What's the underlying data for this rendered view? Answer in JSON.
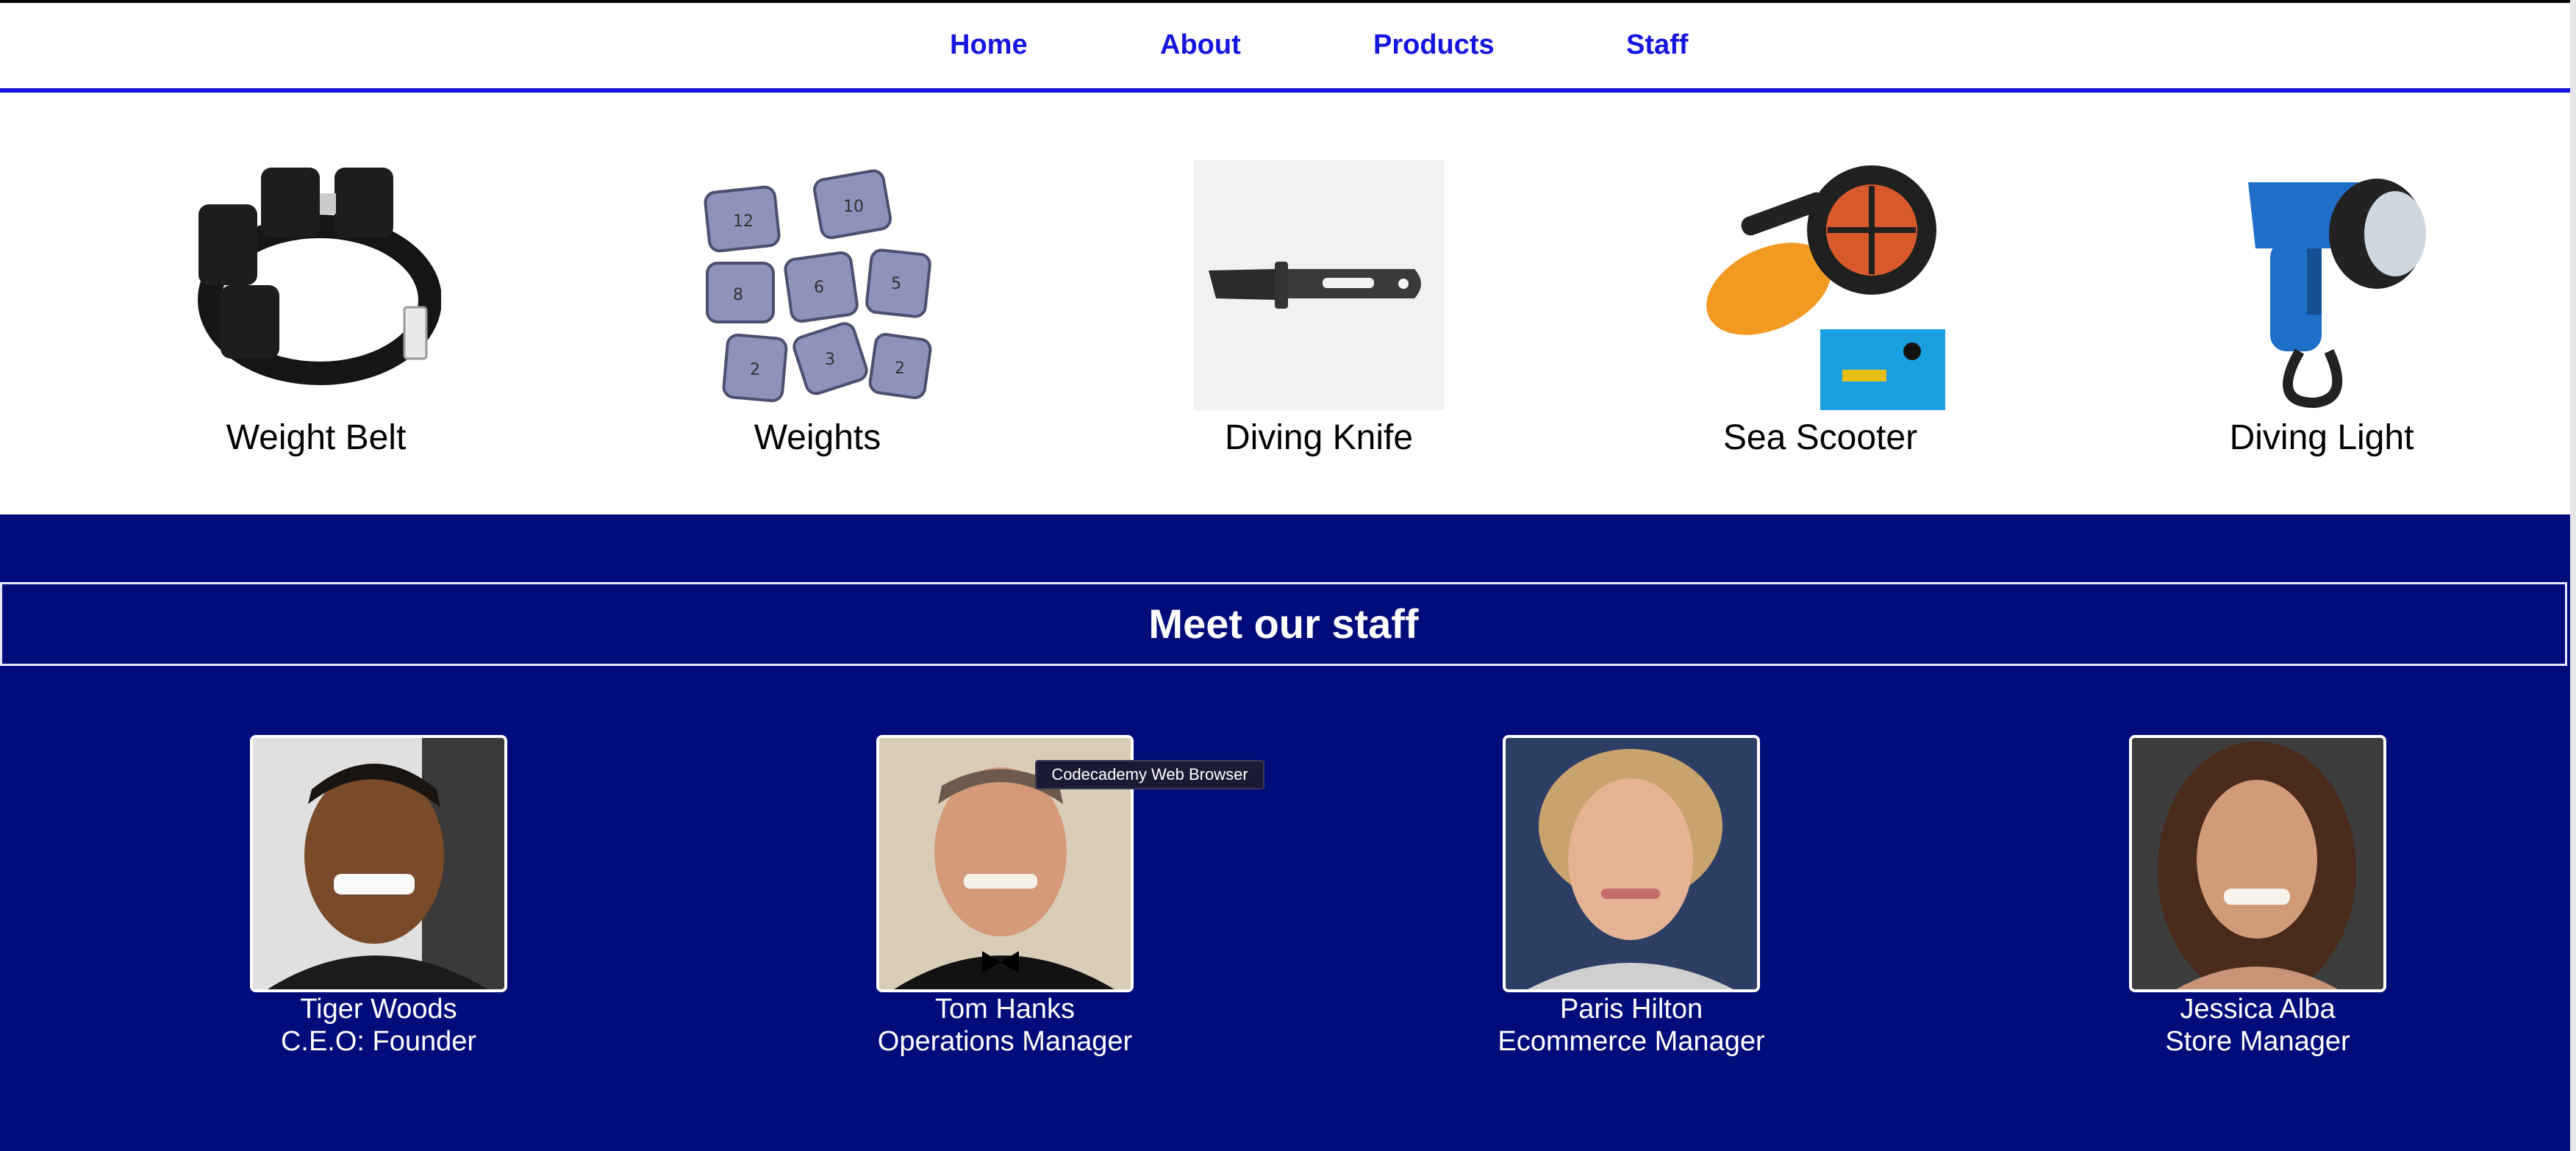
{
  "nav": {
    "items": [
      {
        "label": "Home"
      },
      {
        "label": "About"
      },
      {
        "label": "Products"
      },
      {
        "label": "Staff"
      }
    ]
  },
  "products": [
    {
      "label": "Weight Belt",
      "icon": "weight-belt-image"
    },
    {
      "label": "Weights",
      "icon": "weights-image"
    },
    {
      "label": "Diving Knife",
      "icon": "diving-knife-image"
    },
    {
      "label": "Sea Scooter",
      "icon": "sea-scooter-image"
    },
    {
      "label": "Diving Light",
      "icon": "diving-light-image"
    }
  ],
  "staff": {
    "title": "Meet our staff",
    "people": [
      {
        "name": "Tiger Woods",
        "role": "C.E.O: Founder"
      },
      {
        "name": "Tom Hanks",
        "role": "Operations Manager"
      },
      {
        "name": "Paris Hilton",
        "role": "Ecommerce Manager"
      },
      {
        "name": "Jessica Alba",
        "role": "Store Manager"
      }
    ]
  },
  "tooltip": {
    "text": "Codecademy Web Browser"
  },
  "colors": {
    "nav_link": "#1515e0",
    "nav_rule": "#1414dc",
    "staff_bg": "#000c7a",
    "staff_text": "#ffffff"
  }
}
